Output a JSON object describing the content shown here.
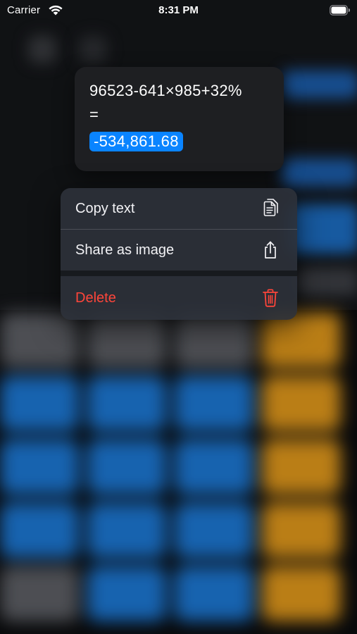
{
  "status_bar": {
    "carrier": "Carrier",
    "time": "8:31 PM",
    "wifi_icon": "wifi-icon",
    "battery_icon": "battery-icon"
  },
  "preview": {
    "expression": "96523-641×985+32%",
    "equals": "=",
    "result": "-534,861.68",
    "highlight_color": "#0a84ff"
  },
  "menu": {
    "items": [
      {
        "label": "Copy text",
        "icon": "copy-icon"
      },
      {
        "label": "Share as image",
        "icon": "share-icon"
      },
      {
        "label": "Delete",
        "icon": "trash-icon",
        "color": "#ff453a"
      }
    ]
  },
  "colors": {
    "key_gray": "#5e6066",
    "key_blue": "#1d79d6",
    "key_orange": "#e39a1c",
    "menu_background": "#2c313a",
    "destructive": "#ff453a"
  }
}
